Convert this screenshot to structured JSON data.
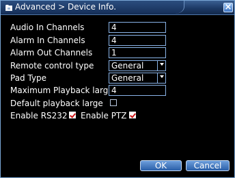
{
  "window": {
    "title": "Advanced > Device Info.",
    "title_icon": "folder-icon",
    "close_icon": "close-icon"
  },
  "form": {
    "audio_in": {
      "label": "Audio In Channels",
      "value": "4"
    },
    "alarm_in": {
      "label": "Alarm In Channels",
      "value": "4"
    },
    "alarm_out": {
      "label": "Alarm Out Channels",
      "value": "1"
    },
    "remote_control": {
      "label": "Remote control type",
      "value": "General"
    },
    "pad_type": {
      "label": "Pad Type",
      "value": "General"
    },
    "max_playback": {
      "label": "Maximum Playback large",
      "value": "4"
    },
    "default_playback": {
      "label": "Default playback large",
      "checked": false
    },
    "enable_rs232": {
      "label": "Enable RS232",
      "checked": true
    },
    "enable_ptz": {
      "label": "Enable PTZ",
      "checked": true
    }
  },
  "buttons": {
    "ok": "OK",
    "cancel": "Cancel"
  },
  "colors": {
    "background": "#000000",
    "accent": "#8ab4e8",
    "title_bar": "#1d3a66",
    "check_mark": "#d01818"
  }
}
